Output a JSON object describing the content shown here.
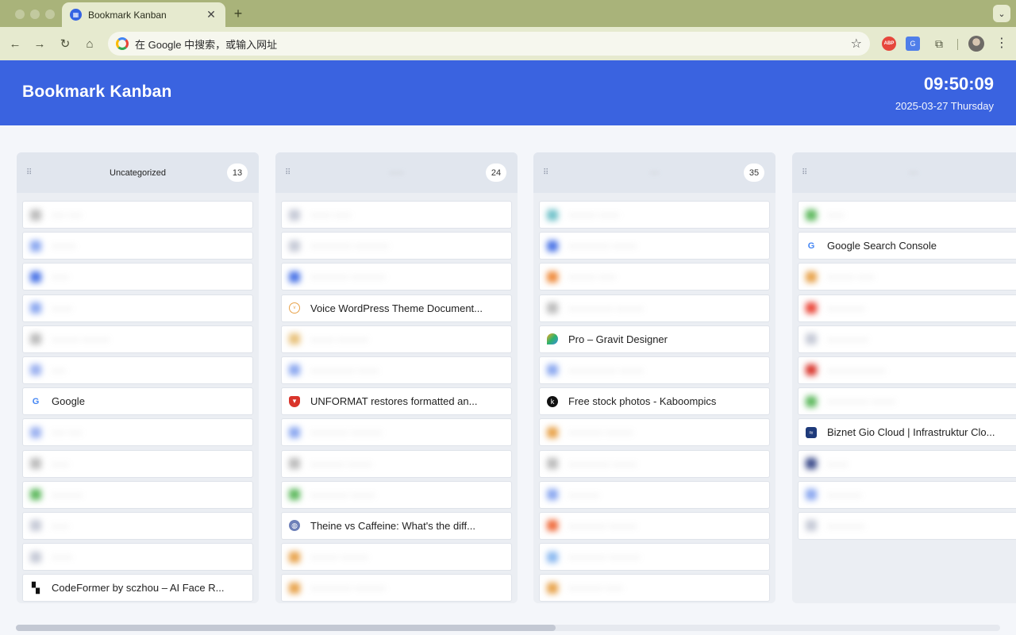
{
  "browser": {
    "tab_title": "Bookmark Kanban",
    "omnibox_placeholder": "在 Google 中搜索，或输入网址",
    "ext_abp": "ABP"
  },
  "header": {
    "title": "Bookmark Kanban",
    "time": "09:50:09",
    "date": "2025-03-27 Thursday"
  },
  "colors": {
    "header_bg": "#3a63e0",
    "accent": "#3a63e0"
  },
  "columns": [
    {
      "title": "Uncategorized",
      "count": "13",
      "cards": [
        {
          "title": "···· ····",
          "icon": "blurred",
          "color": "#bbbbbb"
        },
        {
          "title": "·······",
          "icon": "blurred",
          "color": "#8aa7f0"
        },
        {
          "title": "·····",
          "icon": "blurred",
          "color": "#4a74e6"
        },
        {
          "title": "······",
          "icon": "blurred",
          "color": "#8aa7f0"
        },
        {
          "title": "········ ········",
          "icon": "blurred",
          "color": "#bbbbbb"
        },
        {
          "title": "····",
          "icon": "blurred",
          "color": "#9ab0f0"
        },
        {
          "title": "Google",
          "icon": "google-icon",
          "color": "#4285f4"
        },
        {
          "title": "···· ····",
          "icon": "blurred",
          "color": "#9ab0f0"
        },
        {
          "title": "·····",
          "icon": "blurred",
          "color": "#bbbbbb"
        },
        {
          "title": "·········",
          "icon": "blurred",
          "color": "#5cb85c"
        },
        {
          "title": "·····",
          "icon": "blurred",
          "color": "#c5c9d6"
        },
        {
          "title": "······",
          "icon": "blurred",
          "color": "#c5c9d6"
        },
        {
          "title": "CodeFormer by sczhou – AI Face R...",
          "icon": "codeformer-icon",
          "color": "#111111"
        }
      ]
    },
    {
      "title": "·····",
      "count": "24",
      "cards": [
        {
          "title": "······ ·····",
          "icon": "blurred",
          "color": "#c5c9d6"
        },
        {
          "title": "············ ··········",
          "icon": "blurred",
          "color": "#c5c9d6"
        },
        {
          "title": "··········· ··········",
          "icon": "blurred",
          "color": "#4a74e6"
        },
        {
          "title": "Voice WordPress Theme Document...",
          "icon": "voice-icon",
          "color": "#e8a24a"
        },
        {
          "title": "······· ·········",
          "icon": "blurred",
          "color": "#e8c17a"
        },
        {
          "title": "············· ······",
          "icon": "blurred",
          "color": "#8aa7f0"
        },
        {
          "title": "UNFORMAT restores formatted an...",
          "icon": "shield-icon",
          "color": "#d9342b"
        },
        {
          "title": "··········· ·········",
          "icon": "blurred",
          "color": "#8aa7f0"
        },
        {
          "title": "·········· ·······",
          "icon": "blurred",
          "color": "#bbbbbb"
        },
        {
          "title": "··········· ·······",
          "icon": "blurred",
          "color": "#5cb85c"
        },
        {
          "title": "Theine vs Caffeine: What's the diff...",
          "icon": "globe-icon",
          "color": "#6d7fb8"
        },
        {
          "title": "········ ········",
          "icon": "blurred",
          "color": "#e8a24a"
        },
        {
          "title": "············ ·········",
          "icon": "blurred",
          "color": "#e8a24a"
        }
      ]
    },
    {
      "title": "···",
      "count": "35",
      "cards": [
        {
          "title": "········ ······",
          "icon": "blurred",
          "color": "#6fc1c9"
        },
        {
          "title": "············ ·······",
          "icon": "blurred",
          "color": "#4a74e6"
        },
        {
          "title": "········ ·····",
          "icon": "blurred",
          "color": "#ef8a3a"
        },
        {
          "title": "············· ········",
          "icon": "blurred",
          "color": "#bbbbbb"
        },
        {
          "title": "Pro – Gravit Designer",
          "icon": "gravit-icon",
          "color": "#2db36b"
        },
        {
          "title": "·············· ·······",
          "icon": "blurred",
          "color": "#8aa7f0"
        },
        {
          "title": "Free stock photos - Kaboompics",
          "icon": "kaboompics-icon",
          "color": "#111111"
        },
        {
          "title": "·········· ········",
          "icon": "blurred",
          "color": "#e8a24a"
        },
        {
          "title": "············ ·······",
          "icon": "blurred",
          "color": "#bbbbbb"
        },
        {
          "title": "·········",
          "icon": "blurred",
          "color": "#8aa7f0"
        },
        {
          "title": "··········· ········",
          "icon": "blurred",
          "color": "#ef6a3a"
        },
        {
          "title": "··········· ·········",
          "icon": "blurred",
          "color": "#8ab8f0"
        },
        {
          "title": "·········· ·····",
          "icon": "blurred",
          "color": "#e8a24a"
        }
      ]
    },
    {
      "title": "···",
      "count": "",
      "cards": [
        {
          "title": "·····",
          "icon": "blurred",
          "color": "#5cb85c"
        },
        {
          "title": "Google Search Console",
          "icon": "google-icon",
          "color": "#4285f4"
        },
        {
          "title": "········ ·····",
          "icon": "blurred",
          "color": "#e8a24a"
        },
        {
          "title": "···········",
          "icon": "blurred",
          "color": "#ea4335"
        },
        {
          "title": "············",
          "icon": "blurred",
          "color": "#c5c9d6"
        },
        {
          "title": "·················",
          "icon": "blurred",
          "color": "#d9342b"
        },
        {
          "title": "············ ·······",
          "icon": "blurred",
          "color": "#5cb85c"
        },
        {
          "title": "Biznet Gio Cloud | Infrastruktur Clo...",
          "icon": "biznet-icon",
          "color": "#1e3a7a"
        },
        {
          "title": "······",
          "icon": "blurred",
          "color": "#3a4a8a"
        },
        {
          "title": "··········",
          "icon": "blurred",
          "color": "#8aa7f0"
        },
        {
          "title": "···········",
          "icon": "blurred",
          "color": "#c5c9d6"
        }
      ]
    }
  ]
}
